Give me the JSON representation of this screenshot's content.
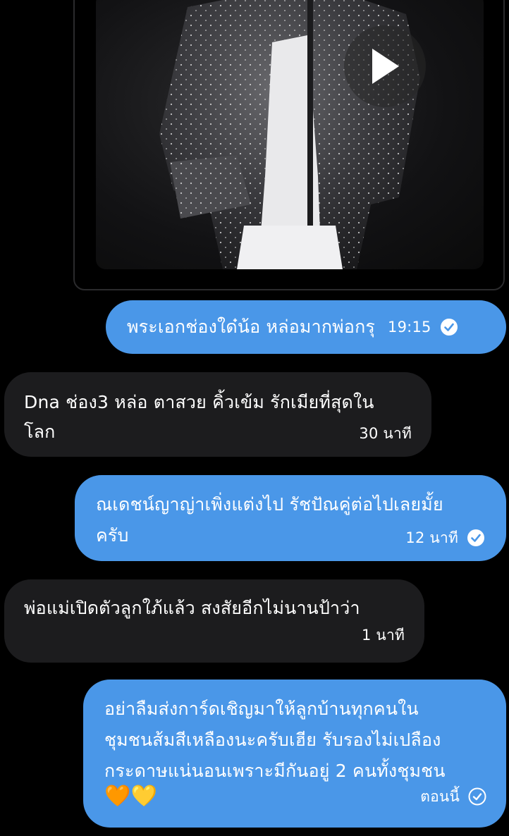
{
  "media": {
    "play_label": "play"
  },
  "messages": [
    {
      "direction": "out",
      "text": "พระเอกช่องใด๋น้อ หล่อมากพ่อกรุ",
      "time": "19:15",
      "status": "read"
    },
    {
      "direction": "in",
      "text": "Dna ช่อง3 หล่อ ตาสวย คิ้วเข้ม รักเมียที่สุดใน\nโลก",
      "time": "30 นาที"
    },
    {
      "direction": "out",
      "text": "ณเดชน์ญาญ่าเพิ่งแต่งไป รัชปัณคู่ต่อไปเลยมั้ย\nครับ",
      "time": "12 นาที",
      "status": "read"
    },
    {
      "direction": "in",
      "text": "พ่อแม่เปิดตัวลูกใภ้แล้ว สงสัยอีกไม่นานป้าว่า",
      "time": "1 นาที"
    },
    {
      "direction": "out",
      "text": "อย่าลืมส่งการ์ดเชิญมาให้ลูกบ้านทุกคนใน\nชุมชนส้มสีเหลืองนะครับเฮีย รับรองไม่เปลือง\nกระดาษแน่นอนเพราะมีกันอยู่ 2 คนทั้งชุมชน",
      "emoji": "🧡💛",
      "time": "ตอนนี้",
      "status": "sent"
    }
  ],
  "colors": {
    "outgoing_bubble": "#4a97e8",
    "incoming_bubble": "#1c1c1e",
    "background": "#000000"
  }
}
